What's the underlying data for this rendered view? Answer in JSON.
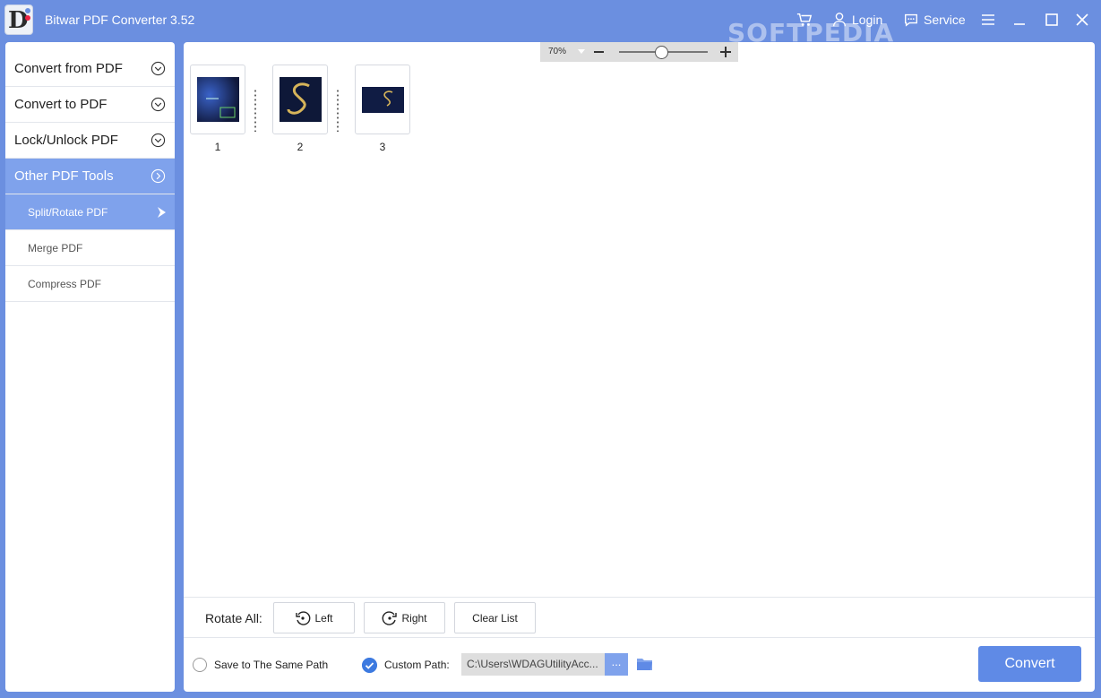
{
  "app": {
    "title": "Bitwar PDF Converter 3.52",
    "logo_letter": "D"
  },
  "titlebar": {
    "login": "Login",
    "service": "Service",
    "watermark": "SOFTPEDIA"
  },
  "sidebar": {
    "items": [
      {
        "label": "Convert from PDF"
      },
      {
        "label": "Convert to PDF"
      },
      {
        "label": "Lock/Unlock PDF"
      },
      {
        "label": "Other PDF Tools"
      }
    ],
    "sub_items": [
      {
        "label": "Split/Rotate PDF"
      },
      {
        "label": "Merge PDF"
      },
      {
        "label": "Compress PDF"
      }
    ]
  },
  "zoom": {
    "level": "70%"
  },
  "pages": [
    {
      "number": "1"
    },
    {
      "number": "2"
    },
    {
      "number": "3"
    }
  ],
  "rotate": {
    "label": "Rotate All:",
    "left": "Left",
    "right": "Right",
    "clear": "Clear List"
  },
  "output": {
    "same_path": "Save to The Same Path",
    "custom_path": "Custom Path:",
    "path_value": "C:\\Users\\WDAGUtilityAcc...",
    "browse": "...",
    "convert": "Convert"
  },
  "colors": {
    "accent": "#6b8fe0",
    "sidebar_active": "#7fa2ec",
    "convert": "#5f8ae6",
    "check": "#3d7ae0"
  }
}
